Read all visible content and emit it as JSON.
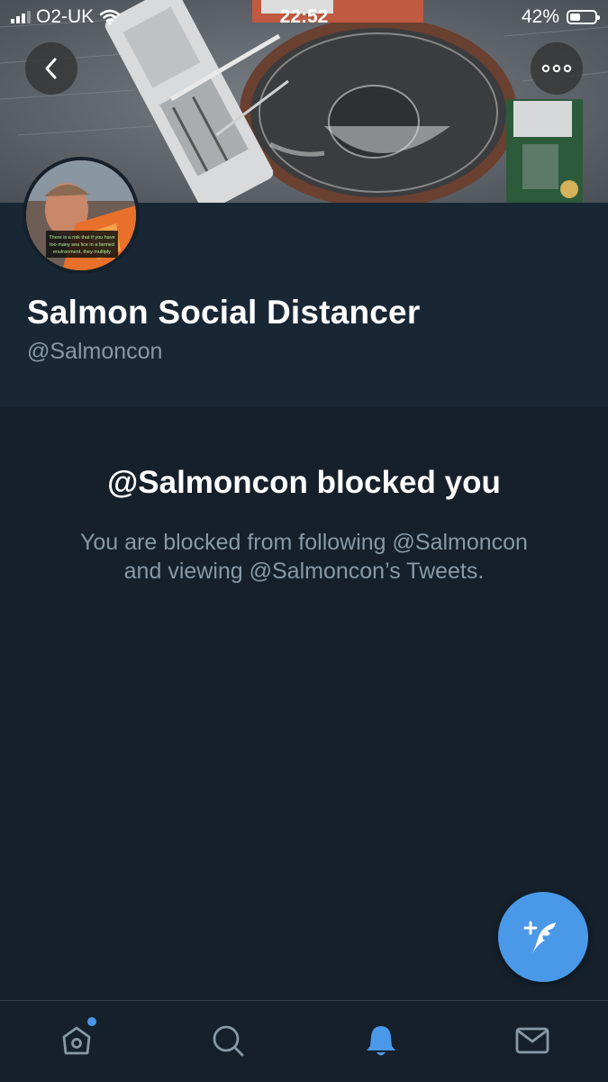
{
  "status_bar": {
    "carrier": "O2-UK",
    "time": "22:52",
    "battery_percent": "42%",
    "battery_level": 0.42,
    "icons": [
      "signal-icon",
      "wifi-icon",
      "battery-icon"
    ]
  },
  "profile": {
    "display_name": "Salmon Social Distancer",
    "handle": "@Salmoncon",
    "avatar_caption": "There is a risk that if you have too many sea lice in a farmed environment, they multiply"
  },
  "blocked": {
    "title": "@Salmoncon blocked you",
    "message_line1": "You are blocked from following @Salmoncon",
    "message_line2": "and viewing @Salmoncon’s Tweets."
  },
  "nav": {
    "back_icon": "chevron-left-icon",
    "more_icon": "more-horizontal-icon",
    "compose_icon": "compose-tweet-icon",
    "tabs": [
      {
        "name": "home",
        "icon": "home-icon",
        "active": false,
        "badge": true
      },
      {
        "name": "search",
        "icon": "search-icon",
        "active": false
      },
      {
        "name": "notifications",
        "icon": "bell-icon",
        "active": true
      },
      {
        "name": "messages",
        "icon": "mail-icon",
        "active": false
      }
    ]
  },
  "colors": {
    "background": "#15202b",
    "header_panel": "#192734",
    "accent": "#4a99e9",
    "secondary_text": "#8899a6"
  }
}
